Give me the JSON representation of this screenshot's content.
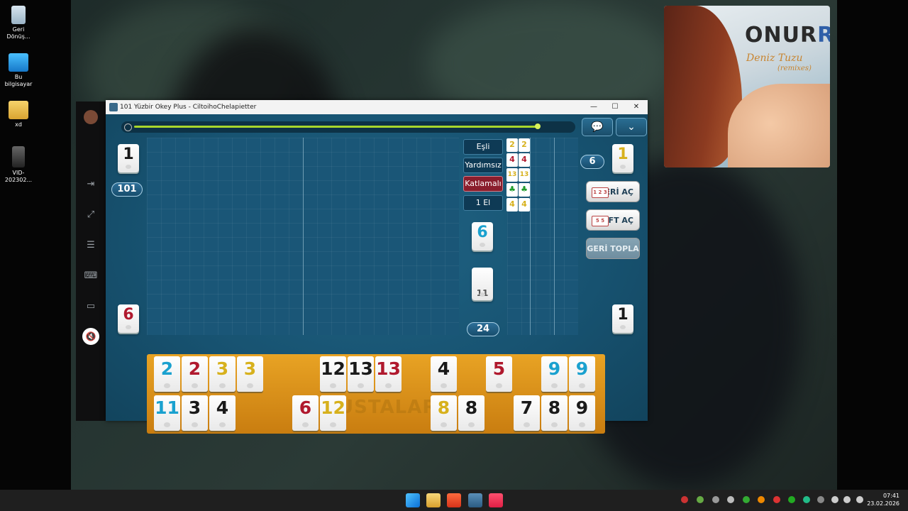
{
  "desktop": {
    "icons": [
      {
        "label": "Geri Dönüş...",
        "icon": "recycle-bin-icon"
      },
      {
        "label": "Bu bilgisayar",
        "icon": "computer-icon"
      },
      {
        "label": "xd",
        "icon": "folder-icon"
      },
      {
        "label": "VID-202302...",
        "icon": "video-file-icon"
      }
    ]
  },
  "window": {
    "title": "101 Yüzbir Okey Plus - CiltoihoChelapietter",
    "controls": {
      "minimize": "—",
      "maximize": "☐",
      "close": "✕"
    }
  },
  "game": {
    "left_indicators": {
      "top_tile": "1",
      "score_badge": "101",
      "bottom_tile": "6"
    },
    "right_indicators": {
      "top_tile": "1",
      "count_badge": "6",
      "bottom_tile": "1"
    },
    "modes": [
      "Eşli",
      "Yardımsız",
      "Katlamalı",
      "1 El"
    ],
    "active_mode": "Katlamalı",
    "mini_tiles": [
      {
        "a": "2",
        "b": "2",
        "color": "#d7b11d"
      },
      {
        "a": "4",
        "b": "4",
        "color": "#b0192e"
      },
      {
        "a": "13",
        "b": "13",
        "color": "#d7b11d"
      },
      {
        "a": "♣",
        "b": "♣",
        "color": "#1e9a2a"
      },
      {
        "a": "4",
        "b": "4",
        "color": "#d7b11d"
      }
    ],
    "indicator_tile": "6",
    "deck_count_tile": "11",
    "remaining_badge": "24",
    "buttons": {
      "seri_ac": "SERİ AÇ",
      "cift_ac": "ÇİFT AÇ",
      "geri_topla": "GERİ TOPLA",
      "seri_cards": "1 2 3",
      "cift_cards": "5 5"
    },
    "rack_watermark": "USTALAR",
    "rack_row1": [
      {
        "n": "2",
        "c": "blue"
      },
      {
        "n": "2",
        "c": "red"
      },
      {
        "n": "3",
        "c": "yellow"
      },
      {
        "n": "3",
        "c": "yellow"
      },
      {
        "n": "12",
        "c": "black"
      },
      {
        "n": "13",
        "c": "black"
      },
      {
        "n": "13",
        "c": "red"
      },
      {
        "n": "4",
        "c": "black"
      },
      {
        "n": "5",
        "c": "red"
      },
      {
        "n": "9",
        "c": "blue"
      },
      {
        "n": "9",
        "c": "blue"
      }
    ],
    "rack_row2": [
      {
        "n": "11",
        "c": "blue"
      },
      {
        "n": "3",
        "c": "black"
      },
      {
        "n": "4",
        "c": "black"
      },
      {
        "n": "6",
        "c": "red"
      },
      {
        "n": "12",
        "c": "yellow"
      },
      {
        "n": "8",
        "c": "yellow"
      },
      {
        "n": "8",
        "c": "black"
      },
      {
        "n": "7",
        "c": "black"
      },
      {
        "n": "8",
        "c": "black"
      },
      {
        "n": "9",
        "c": "black"
      }
    ],
    "timer_progress": 0.93
  },
  "album": {
    "artist": "ONUR",
    "artist_tail": "R",
    "song": "Deniz Tuzu",
    "subtitle": "(remixes)"
  },
  "taskbar": {
    "time": "07:41",
    "date": "23.02.2026"
  }
}
